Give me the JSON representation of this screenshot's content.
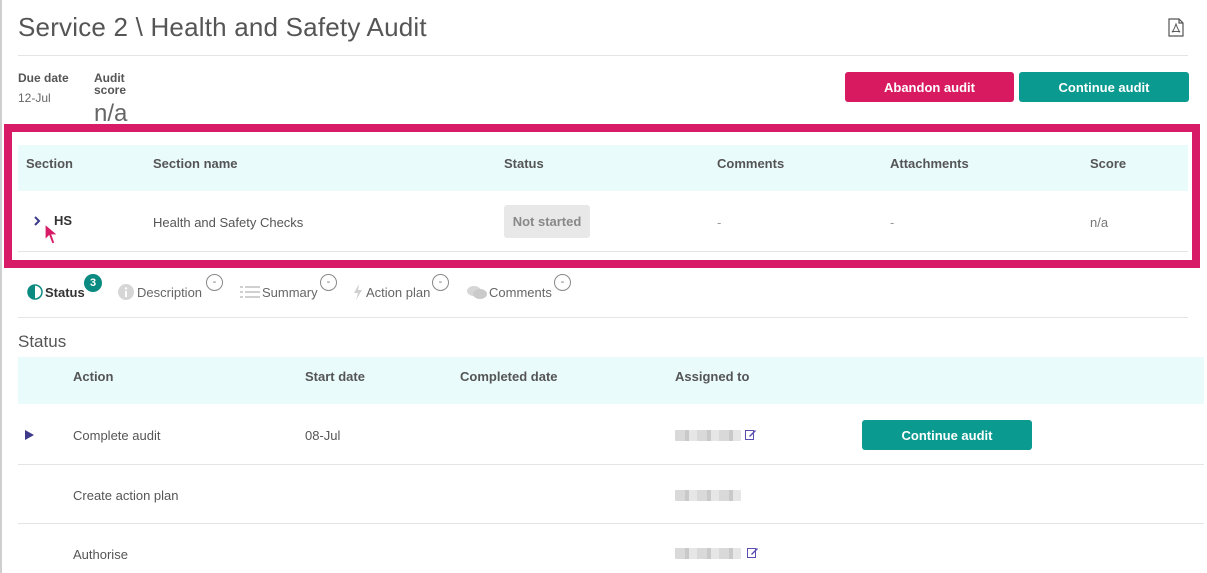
{
  "page": {
    "title": "Service 2 \\ Health and Safety Audit",
    "pdf_icon": "pdf-document-icon"
  },
  "meta": {
    "due_date_label": "Due date",
    "due_date_value": "12-Jul",
    "audit_score_label_line1": "Audit",
    "audit_score_label_line2": "score",
    "audit_score_value": "n/a"
  },
  "actions": {
    "abandon_label": "Abandon audit",
    "continue_label": "Continue audit"
  },
  "colors": {
    "accent_pink": "#d81b60",
    "accent_teal": "#0a9a8f",
    "highlight_border": "#d81b66",
    "table_header_bg": "#eafbfc"
  },
  "sections_table": {
    "headers": [
      "Section",
      "Section name",
      "Status",
      "Comments",
      "Attachments",
      "Score"
    ],
    "rows": [
      {
        "expand_icon": "chevron-right-icon",
        "section": "HS",
        "name": "Health and Safety Checks",
        "status": "Not started",
        "comments": "-",
        "attachments": "-",
        "score": "n/a"
      }
    ]
  },
  "tabs": [
    {
      "label": "Status",
      "icon": "half-circle-icon",
      "badge": "3",
      "active": true
    },
    {
      "label": "Description",
      "icon": "info-icon",
      "badge": "-"
    },
    {
      "label": "Summary",
      "icon": "list-icon",
      "badge": "-"
    },
    {
      "label": "Action plan",
      "icon": "lightning-icon",
      "badge": "-"
    },
    {
      "label": "Comments",
      "icon": "chat-bubbles-icon",
      "badge": "-"
    }
  ],
  "status_section": {
    "title": "Status",
    "headers": [
      "Action",
      "Start date",
      "Completed date",
      "Assigned to"
    ],
    "rows": [
      {
        "action": "Complete audit",
        "start_date": "08-Jul",
        "completed_date": "",
        "button_label": "Continue audit"
      },
      {
        "action": "Create action plan",
        "start_date": "",
        "completed_date": ""
      },
      {
        "action": "Authorise",
        "start_date": "",
        "completed_date": ""
      }
    ]
  }
}
